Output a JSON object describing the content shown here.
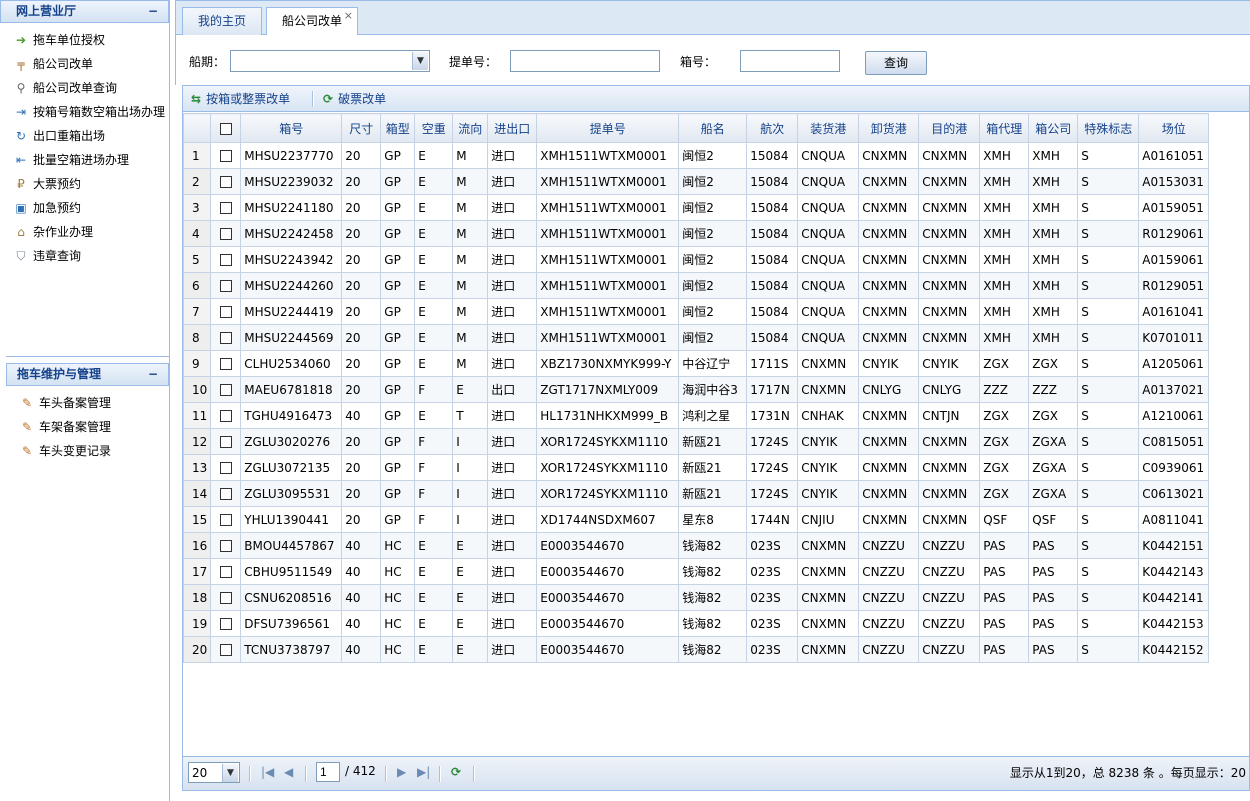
{
  "sidebar": {
    "panel1": {
      "title": "网上营业厅",
      "collapse": "−",
      "items": [
        {
          "label": "拖车单位授权",
          "icon": "arrow-right-icon"
        },
        {
          "label": "船公司改单",
          "icon": "signpost-icon"
        },
        {
          "label": "船公司改单查询",
          "icon": "magnifier-icon"
        },
        {
          "label": "按箱号箱数空箱出场办理",
          "icon": "exit-icon"
        },
        {
          "label": "出口重箱出场",
          "icon": "refresh-icon"
        },
        {
          "label": "批量空箱进场办理",
          "icon": "enter-icon"
        },
        {
          "label": "大票预约",
          "icon": "coin-icon"
        },
        {
          "label": "加急预约",
          "icon": "picture-icon"
        },
        {
          "label": "杂作业办理",
          "icon": "building-icon"
        },
        {
          "label": "违章查询",
          "icon": "tag-icon"
        }
      ]
    },
    "panel2": {
      "title": "拖车维护与管理",
      "collapse": "−",
      "items": [
        {
          "label": "车头备案管理",
          "icon": "pencil-icon"
        },
        {
          "label": "车架备案管理",
          "icon": "pencil-icon"
        },
        {
          "label": "车头变更记录",
          "icon": "pencil-icon"
        }
      ]
    }
  },
  "tabs": [
    {
      "label": "我的主页"
    },
    {
      "label": "船公司改单",
      "close": "×"
    }
  ],
  "search": {
    "ship_label": "船期：",
    "ship_value": "",
    "bl_label": "提单号：",
    "bl_value": "",
    "box_label": "箱号：",
    "box_value": "",
    "query_button": "查询"
  },
  "toolbar": {
    "btn1": "按箱或整票改单",
    "btn2": "破票改单"
  },
  "columns": [
    "",
    "",
    "箱号",
    "尺寸",
    "箱型",
    "空重",
    "流向",
    "进出口",
    "提单号",
    "船名",
    "航次",
    "装货港",
    "卸货港",
    "目的港",
    "箱代理",
    "箱公司",
    "特殊标志",
    "场位"
  ],
  "rows": [
    [
      "1",
      "",
      "MHSU2237770",
      "20",
      "GP",
      "E",
      "M",
      "进口",
      "XMH1511WTXM0001",
      "闽恒2",
      "15084",
      "CNQUA",
      "CNXMN",
      "CNXMN",
      "XMH",
      "XMH",
      "S",
      "A0161051"
    ],
    [
      "2",
      "",
      "MHSU2239032",
      "20",
      "GP",
      "E",
      "M",
      "进口",
      "XMH1511WTXM0001",
      "闽恒2",
      "15084",
      "CNQUA",
      "CNXMN",
      "CNXMN",
      "XMH",
      "XMH",
      "S",
      "A0153031"
    ],
    [
      "3",
      "",
      "MHSU2241180",
      "20",
      "GP",
      "E",
      "M",
      "进口",
      "XMH1511WTXM0001",
      "闽恒2",
      "15084",
      "CNQUA",
      "CNXMN",
      "CNXMN",
      "XMH",
      "XMH",
      "S",
      "A0159051"
    ],
    [
      "4",
      "",
      "MHSU2242458",
      "20",
      "GP",
      "E",
      "M",
      "进口",
      "XMH1511WTXM0001",
      "闽恒2",
      "15084",
      "CNQUA",
      "CNXMN",
      "CNXMN",
      "XMH",
      "XMH",
      "S",
      "R0129061"
    ],
    [
      "5",
      "",
      "MHSU2243942",
      "20",
      "GP",
      "E",
      "M",
      "进口",
      "XMH1511WTXM0001",
      "闽恒2",
      "15084",
      "CNQUA",
      "CNXMN",
      "CNXMN",
      "XMH",
      "XMH",
      "S",
      "A0159061"
    ],
    [
      "6",
      "",
      "MHSU2244260",
      "20",
      "GP",
      "E",
      "M",
      "进口",
      "XMH1511WTXM0001",
      "闽恒2",
      "15084",
      "CNQUA",
      "CNXMN",
      "CNXMN",
      "XMH",
      "XMH",
      "S",
      "R0129051"
    ],
    [
      "7",
      "",
      "MHSU2244419",
      "20",
      "GP",
      "E",
      "M",
      "进口",
      "XMH1511WTXM0001",
      "闽恒2",
      "15084",
      "CNQUA",
      "CNXMN",
      "CNXMN",
      "XMH",
      "XMH",
      "S",
      "A0161041"
    ],
    [
      "8",
      "",
      "MHSU2244569",
      "20",
      "GP",
      "E",
      "M",
      "进口",
      "XMH1511WTXM0001",
      "闽恒2",
      "15084",
      "CNQUA",
      "CNXMN",
      "CNXMN",
      "XMH",
      "XMH",
      "S",
      "K0701011"
    ],
    [
      "9",
      "",
      "CLHU2534060",
      "20",
      "GP",
      "E",
      "M",
      "进口",
      "XBZ1730NXMYK999-Y",
      "中谷辽宁",
      "1711S",
      "CNXMN",
      "CNYIK",
      "CNYIK",
      "ZGX",
      "ZGX",
      "S",
      "A1205061"
    ],
    [
      "10",
      "",
      "MAEU6781818",
      "20",
      "GP",
      "F",
      "E",
      "出口",
      "ZGT1717NXMLY009",
      "海润中谷3",
      "1717N",
      "CNXMN",
      "CNLYG",
      "CNLYG",
      "ZZZ",
      "ZZZ",
      "S",
      "A0137021"
    ],
    [
      "11",
      "",
      "TGHU4916473",
      "40",
      "GP",
      "E",
      "T",
      "进口",
      "HL1731NHKXM999_B",
      "鸿利之星",
      "1731N",
      "CNHAK",
      "CNXMN",
      "CNTJN",
      "ZGX",
      "ZGX",
      "S",
      "A1210061"
    ],
    [
      "12",
      "",
      "ZGLU3020276",
      "20",
      "GP",
      "F",
      "I",
      "进口",
      "XOR1724SYKXM1110",
      "新瓯21",
      "1724S",
      "CNYIK",
      "CNXMN",
      "CNXMN",
      "ZGX",
      "ZGXA",
      "S",
      "C0815051"
    ],
    [
      "13",
      "",
      "ZGLU3072135",
      "20",
      "GP",
      "F",
      "I",
      "进口",
      "XOR1724SYKXM1110",
      "新瓯21",
      "1724S",
      "CNYIK",
      "CNXMN",
      "CNXMN",
      "ZGX",
      "ZGXA",
      "S",
      "C0939061"
    ],
    [
      "14",
      "",
      "ZGLU3095531",
      "20",
      "GP",
      "F",
      "I",
      "进口",
      "XOR1724SYKXM1110",
      "新瓯21",
      "1724S",
      "CNYIK",
      "CNXMN",
      "CNXMN",
      "ZGX",
      "ZGXA",
      "S",
      "C0613021"
    ],
    [
      "15",
      "",
      "YHLU1390441",
      "20",
      "GP",
      "F",
      "I",
      "进口",
      "XD1744NSDXM607",
      "星东8",
      "1744N",
      "CNJIU",
      "CNXMN",
      "CNXMN",
      "QSF",
      "QSF",
      "S",
      "A0811041"
    ],
    [
      "16",
      "",
      "BMOU4457867",
      "40",
      "HC",
      "E",
      "E",
      "进口",
      "E0003544670",
      "钱海82",
      "023S",
      "CNXMN",
      "CNZZU",
      "CNZZU",
      "PAS",
      "PAS",
      "S",
      "K0442151"
    ],
    [
      "17",
      "",
      "CBHU9511549",
      "40",
      "HC",
      "E",
      "E",
      "进口",
      "E0003544670",
      "钱海82",
      "023S",
      "CNXMN",
      "CNZZU",
      "CNZZU",
      "PAS",
      "PAS",
      "S",
      "K0442143"
    ],
    [
      "18",
      "",
      "CSNU6208516",
      "40",
      "HC",
      "E",
      "E",
      "进口",
      "E0003544670",
      "钱海82",
      "023S",
      "CNXMN",
      "CNZZU",
      "CNZZU",
      "PAS",
      "PAS",
      "S",
      "K0442141"
    ],
    [
      "19",
      "",
      "DFSU7396561",
      "40",
      "HC",
      "E",
      "E",
      "进口",
      "E0003544670",
      "钱海82",
      "023S",
      "CNXMN",
      "CNZZU",
      "CNZZU",
      "PAS",
      "PAS",
      "S",
      "K0442153"
    ],
    [
      "20",
      "",
      "TCNU3738797",
      "40",
      "HC",
      "E",
      "E",
      "进口",
      "E0003544670",
      "钱海82",
      "023S",
      "CNXMN",
      "CNZZU",
      "CNZZU",
      "PAS",
      "PAS",
      "S",
      "K0442152"
    ]
  ],
  "pager": {
    "page_size": "20",
    "current_page": "1",
    "total_pages": "/ 412",
    "summary": "显示从1到20，总 8238 条 。每页显示：20"
  }
}
